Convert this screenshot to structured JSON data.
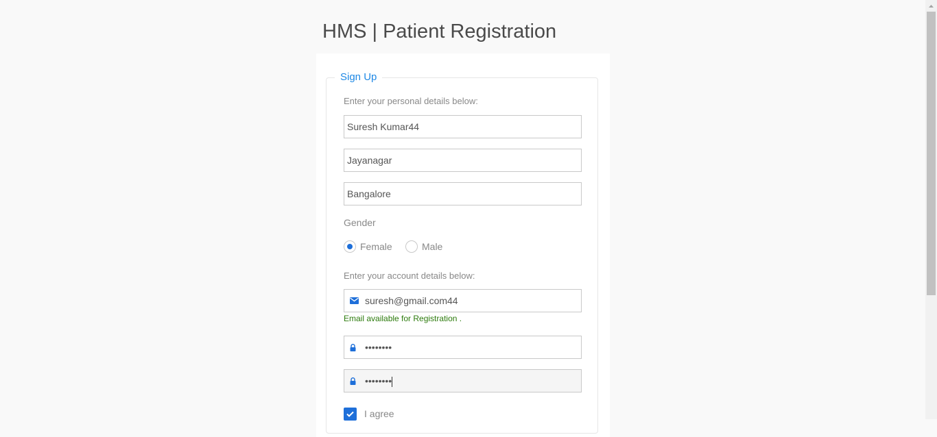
{
  "page": {
    "title": "HMS | Patient Registration"
  },
  "form": {
    "legend": "Sign Up",
    "personal_heading": "Enter your personal details below:",
    "full_name": {
      "value": "Suresh Kumar44"
    },
    "address": {
      "value": "Jayanagar"
    },
    "city": {
      "value": "Bangalore"
    },
    "gender": {
      "label": "Gender",
      "options": [
        {
          "label": "Female",
          "checked": true
        },
        {
          "label": "Male",
          "checked": false
        }
      ]
    },
    "account_heading": "Enter your account details below:",
    "email": {
      "value": "suresh@gmail.com44",
      "icon": "envelope-icon"
    },
    "email_status": "Email available for Registration .",
    "password": {
      "value": "••••••••",
      "icon": "lock-icon"
    },
    "confirm_password": {
      "value": "••••••••",
      "icon": "lock-icon"
    },
    "agree": {
      "label": "I agree",
      "checked": true
    }
  },
  "colors": {
    "accent": "#1e6fd9",
    "success": "#2b7a0b",
    "background": "#f9f9f9"
  }
}
